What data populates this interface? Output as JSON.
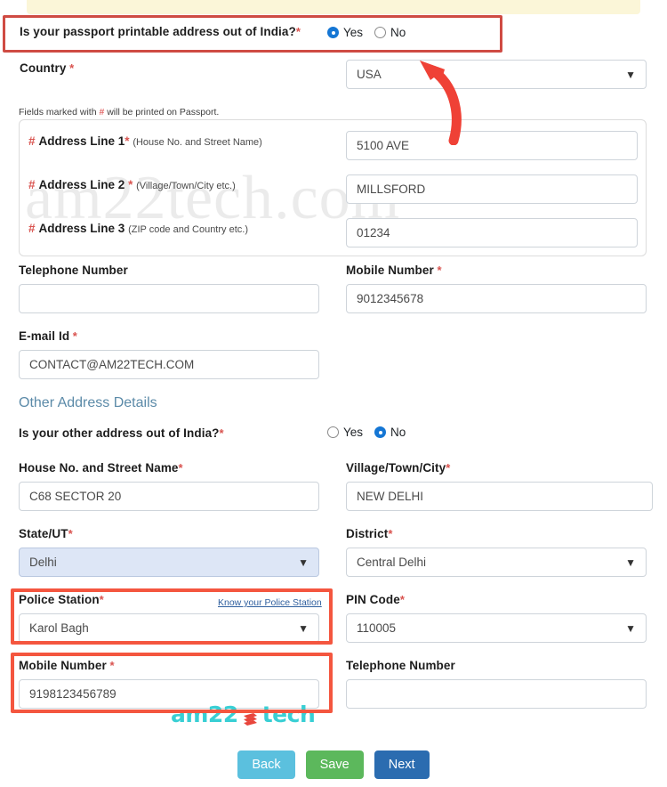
{
  "form": {
    "passport_address_question": {
      "label": "Is your passport printable address out of India?",
      "required_mark": "*",
      "options": [
        "Yes",
        "No"
      ],
      "selected": "Yes"
    },
    "country": {
      "label": "Country",
      "required_mark": "*",
      "value": "USA"
    },
    "printed_note": {
      "prefix": "Fields marked with ",
      "hash": "#",
      "suffix": " will be printed on Passport."
    },
    "address_lines": [
      {
        "hash": "#",
        "label": "Address Line 1",
        "required_mark": "*",
        "hint": "(House No. and Street Name)",
        "value": "5100 AVE"
      },
      {
        "hash": "#",
        "label": "Address Line 2 ",
        "required_mark": "*",
        "hint": "(Village/Town/City etc.)",
        "value": "MILLSFORD"
      },
      {
        "hash": "#",
        "label": "Address Line 3",
        "required_mark": "",
        "hint": "(ZIP code and Country etc.)",
        "value": "01234"
      }
    ],
    "telephone_primary": {
      "label": "Telephone Number",
      "required_mark": "",
      "value": ""
    },
    "mobile_primary": {
      "label": "Mobile Number",
      "required_mark": "*",
      "value": "9012345678"
    },
    "email": {
      "label": "E-mail Id",
      "required_mark": "*",
      "value": "CONTACT@AM22TECH.COM"
    },
    "other_address_heading": "Other Address Details",
    "other_address_question": {
      "label": "Is your other address out of India?",
      "required_mark": "*",
      "options": [
        "Yes",
        "No"
      ],
      "selected": "No"
    },
    "house_street": {
      "label": "House No. and Street Name",
      "required_mark": "*",
      "value": "C68 SECTOR 20"
    },
    "village_town_city": {
      "label": "Village/Town/City",
      "required_mark": "*",
      "value": "NEW DELHI"
    },
    "state_ut": {
      "label": "State/UT",
      "required_mark": "*",
      "value": "Delhi"
    },
    "district": {
      "label": "District",
      "required_mark": "*",
      "value": "Central Delhi"
    },
    "police_station": {
      "label": "Police Station",
      "required_mark": "*",
      "link_label": "Know your Police Station",
      "value": "Karol Bagh"
    },
    "pin_code": {
      "label": "PIN Code",
      "required_mark": "*",
      "value": "110005"
    },
    "mobile_other": {
      "label": "Mobile Number",
      "required_mark": "*",
      "value": "9198123456789"
    },
    "telephone_other": {
      "label": "Telephone Number",
      "required_mark": "",
      "value": ""
    }
  },
  "buttons": {
    "back": "Back",
    "save": "Save",
    "next": "Next"
  },
  "watermark": {
    "text": "am22tech.com"
  },
  "logo": {
    "left": "am22",
    "right": "tech"
  },
  "colors": {
    "annotation_red": "#f4563f",
    "radio_blue": "#1576d4",
    "heading_blue": "#5b8aa8",
    "btn_back": "#5bc0de",
    "btn_save": "#5cb85c",
    "btn_next": "#2b6cb0",
    "logo_teal": "#39cfd4",
    "banner_cream": "#fbf6d8",
    "required_red": "#d9534f"
  }
}
